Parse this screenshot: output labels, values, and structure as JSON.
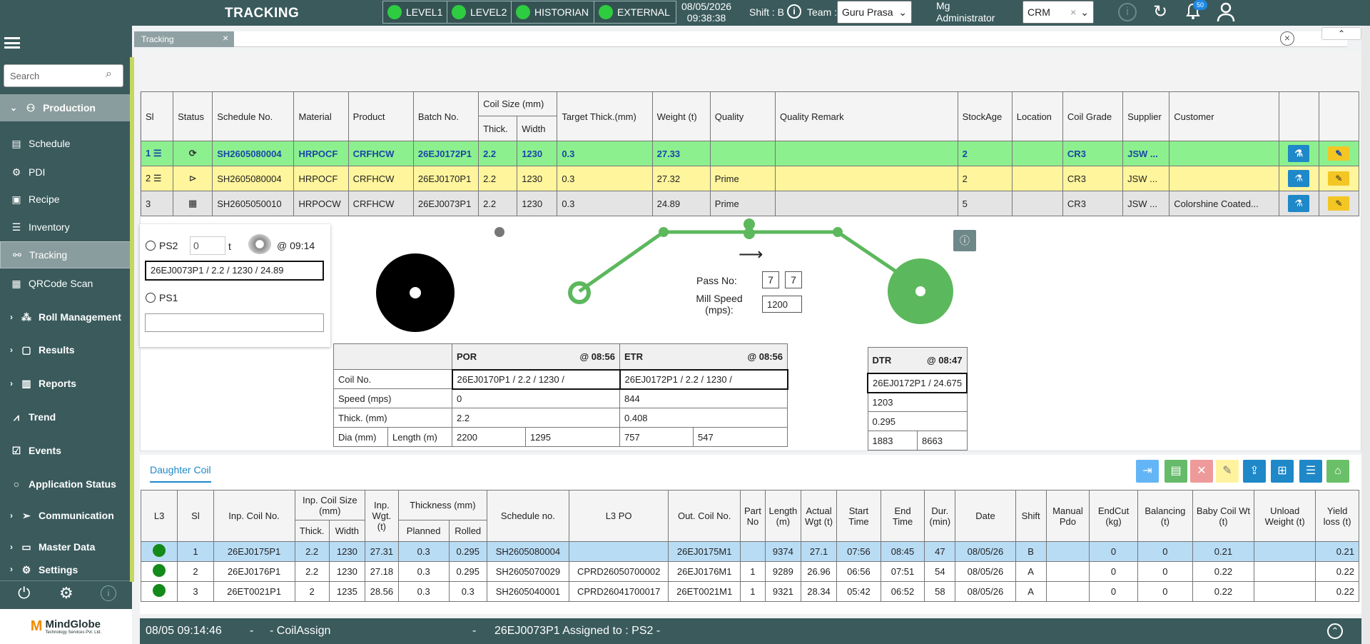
{
  "header": {
    "title": "TRACKING",
    "levels": [
      "LEVEL1",
      "LEVEL2",
      "HISTORIAN",
      "EXTERNAL"
    ],
    "date": "08/05/2026",
    "time": "09:38:38",
    "shift": "Shift : B",
    "team_label": "Team :",
    "team": "Guru Prasa",
    "user_line1": "Mg",
    "user_line2": "Administrator",
    "crm": "CRM",
    "notifications": "50"
  },
  "sidebar": {
    "search_placeholder": "Search",
    "items": {
      "production": "Production",
      "schedule": "Schedule",
      "pdi": "PDI",
      "recipe": "Recipe",
      "inventory": "Inventory",
      "tracking": "Tracking",
      "qrcode": "QRCode Scan",
      "roll": "Roll Management",
      "results": "Results",
      "reports": "Reports",
      "trend": "Trend",
      "events": "Events",
      "appstatus": "Application Status",
      "communication": "Communication",
      "master": "Master Data",
      "settings": "Settings"
    },
    "logo": "MindGlobe",
    "logo_sub": "Technology Services Pvt. Ltd."
  },
  "tab": {
    "label": "Tracking"
  },
  "schedule": {
    "headers": [
      "Sl",
      "Status",
      "Schedule No.",
      "Material",
      "Product",
      "Batch No.",
      "Coil Size (mm)",
      "Thick.",
      "Width",
      "Target Thick.(mm)",
      "Weight (t)",
      "Quality",
      "Quality Remark",
      "StockAge",
      "Location",
      "Coil Grade",
      "Supplier",
      "Customer"
    ],
    "rows": [
      [
        "1",
        "SH2605080004",
        "HRPOCF",
        "CRFHCW",
        "26EJ0172P1",
        "2.2",
        "1230",
        "0.3",
        "27.33",
        "",
        "",
        "2",
        "",
        "CR3",
        "JSW ...",
        ""
      ],
      [
        "2",
        "SH2605080004",
        "HRPOCF",
        "CRFHCW",
        "26EJ0170P1",
        "2.2",
        "1230",
        "0.3",
        "27.32",
        "Prime",
        "",
        "2",
        "",
        "CR3",
        "JSW ...",
        ""
      ],
      [
        "3",
        "SH2605050010",
        "HRPOCW",
        "CRFHCW",
        "26EJ0073P1",
        "2.2",
        "1230",
        "0.3",
        "24.89",
        "Prime",
        "",
        "5",
        "",
        "CR3",
        "JSW ...",
        "Colorshine Coated..."
      ]
    ]
  },
  "ps": {
    "ps2": "PS2",
    "ps2_val": "0",
    "unit": "t",
    "ps2_time": "@ 09:14",
    "ps2_coil": "26EJ0073P1 / 2.2 / 1230 / 24.89",
    "ps1": "PS1"
  },
  "mill": {
    "pass_label": "Pass No:",
    "pass1": "7",
    "pass2": "7",
    "speed_label": "Mill Speed (mps):",
    "speed": "1200",
    "arrow": "⟶"
  },
  "por": {
    "h_por": "POR",
    "h_por_t": "@ 08:56",
    "h_etr": "ETR",
    "h_etr_t": "@ 08:56",
    "lbl_coil": "Coil No.",
    "lbl_speed": "Speed (mps)",
    "lbl_thick": "Thick. (mm)",
    "lbl_dia": "Dia (mm)",
    "lbl_len": "Length (m)",
    "por_coil": "26EJ0170P1 / 2.2 / 1230 /",
    "etr_coil": "26EJ0172P1 / 2.2 / 1230 /",
    "por_speed": "0",
    "etr_speed": "844",
    "por_thick": "2.2",
    "etr_thick": "0.408",
    "por_dia": "2200",
    "por_len": "1295",
    "etr_dia": "757",
    "etr_len": "547"
  },
  "dtr": {
    "h": "DTR",
    "t": "@ 08:47",
    "coil": "26EJ0172P1 / 24.675",
    "speed": "1203",
    "thick": "0.295",
    "dia": "1883",
    "len": "8663"
  },
  "daughter": {
    "tab": "Daughter Coil",
    "headers": {
      "l3": "L3",
      "sl": "Sl",
      "inp": "Inp. Coil No.",
      "size": "Inp. Coil Size (mm)",
      "thick": "Thick.",
      "width": "Width",
      "wgt": "Inp. Wgt. (t)",
      "thk": "Thickness (mm)",
      "planned": "Planned",
      "rolled": "Rolled",
      "sched": "Schedule no.",
      "po": "L3 PO",
      "out": "Out. Coil No.",
      "part": "Part No",
      "len": "Length (m)",
      "act": "Actual Wgt (t)",
      "start": "Start Time",
      "end": "End Time",
      "dur": "Dur. (min)",
      "date": "Date",
      "shift": "Shift",
      "mpdo": "Manual Pdo",
      "endcut": "EndCut (kg)",
      "bal": "Balancing (t)",
      "baby": "Baby Coil Wt (t)",
      "unload": "Unload Weight (t)",
      "yield": "Yield loss (t)"
    },
    "rows": [
      [
        "1",
        "26EJ0175P1",
        "2.2",
        "1230",
        "27.31",
        "0.3",
        "0.295",
        "SH2605080004",
        "",
        "26EJ0175M1",
        "",
        "9374",
        "27.1",
        "07:56",
        "08:45",
        "47",
        "08/05/26",
        "B",
        "",
        "0",
        "0",
        "0.21",
        "",
        "0.21"
      ],
      [
        "2",
        "26EJ0176P1",
        "2.2",
        "1230",
        "27.18",
        "0.3",
        "0.295",
        "SH2605070029",
        "CPRD26050700002",
        "26EJ0176M1",
        "1",
        "9289",
        "26.96",
        "06:56",
        "07:51",
        "54",
        "08/05/26",
        "A",
        "",
        "0",
        "0",
        "0.22",
        "",
        "0.22"
      ],
      [
        "3",
        "26ET0021P1",
        "2",
        "1235",
        "28.56",
        "0.3",
        "0.3",
        "SH2605040001",
        "CPRD26041700017",
        "26ET0021M1",
        "1",
        "9321",
        "28.34",
        "05:42",
        "06:52",
        "58",
        "08/05/26",
        "A",
        "",
        "0",
        "0",
        "0.22",
        "",
        "0.22"
      ]
    ]
  },
  "status": {
    "time": "08/05 09:14:46",
    "sep1": "-",
    "event": "- CoilAssign",
    "sep2": "-",
    "msg": "26EJ0073P1 Assigned to : PS2 -"
  }
}
